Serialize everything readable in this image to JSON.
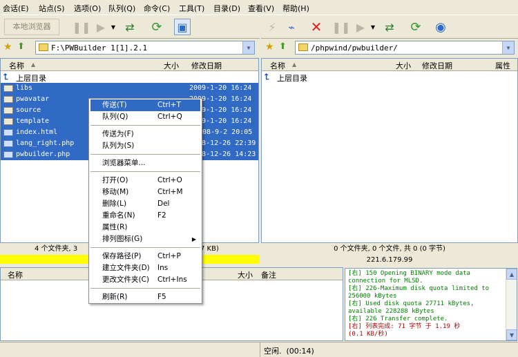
{
  "menu": [
    "会话(E)",
    "站点(S)",
    "选项(O)",
    "队列(Q)",
    "命令(C)",
    "工具(T)",
    "目录(D)",
    "查看(V)",
    "帮助(H)"
  ],
  "left": {
    "browse_label": "本地浏览器",
    "path": "F:\\PWBuilder 1[1].2.1",
    "col_name": "名称",
    "col_size": "大小",
    "col_date": "修改日期",
    "up_label": "上层目录",
    "files": [
      {
        "name": "libs",
        "date": "2009-1-20 16:24"
      },
      {
        "name": "pwavatar",
        "date": "2009-1-20 16:24"
      },
      {
        "name": "source",
        "date": "2009-1-20 16:24"
      },
      {
        "name": "template",
        "date": "2009-1-20 16:24"
      },
      {
        "name": "index.html",
        "date": "2008-9-2 20:05"
      },
      {
        "name": "lang_right.php",
        "date": "2008-12-26 22:39"
      },
      {
        "name": "pwbuilder.php",
        "date": "2008-12-26 14:23"
      }
    ],
    "status": "4 个文件夹, 3",
    "status_tail": "7 KB)"
  },
  "right": {
    "path": "/phpwind/pwbuilder/",
    "col_name": "名称",
    "col_size": "大小",
    "col_date": "修改日期",
    "col_attr": "属性",
    "up_label": "上层目录",
    "status": "0 个文件夹, 0 个文件, 共 0 (0 字节)",
    "server": "221.6.179.99"
  },
  "queue": {
    "col_name": "名称",
    "col_size": "大小",
    "col_note": "备注"
  },
  "context_menu": [
    {
      "label": "传送(T)",
      "shortcut": "Ctrl+T"
    },
    {
      "label": "队列(Q)",
      "shortcut": "Ctrl+Q"
    },
    {
      "label": "传送为(F)",
      "shortcut": ""
    },
    {
      "label": "队列为(S)",
      "shortcut": ""
    },
    {
      "label": "浏览器菜单...",
      "shortcut": ""
    },
    {
      "label": "打开(O)",
      "shortcut": "Ctrl+O"
    },
    {
      "label": "移动(M)",
      "shortcut": "Ctrl+M"
    },
    {
      "label": "删除(L)",
      "shortcut": "Del"
    },
    {
      "label": "重命名(N)",
      "shortcut": "F2"
    },
    {
      "label": "属性(R)",
      "shortcut": ""
    },
    {
      "label": "排列图标(G)",
      "shortcut": ""
    },
    {
      "label": "保存路径(P)",
      "shortcut": "Ctrl+P"
    },
    {
      "label": "建立文件夹(D)",
      "shortcut": "Ins"
    },
    {
      "label": "更改文件夹(C)",
      "shortcut": "Ctrl+Ins"
    },
    {
      "label": "刷新(R)",
      "shortcut": "F5"
    }
  ],
  "log": [
    "[右] 150 Opening BINARY mode data",
    "connection for MLSD.",
    "[右] 226-Maximum disk quota limited to",
    "256000 kBytes",
    "[右]      Used disk quota 27711 kBytes,",
    "available 228288 kBytes",
    "[右] 226 Transfer complete.",
    "[右] 列表完成: 71 字节 于 1.19 秒",
    "(0.1 KB/秒)"
  ],
  "bottom_status": "空闲.  (00:14)",
  "colors": {
    "selection": "#316ac5",
    "log_green": "#008000",
    "log_red": "#b00000",
    "highlight_bar": "#ffff00"
  }
}
